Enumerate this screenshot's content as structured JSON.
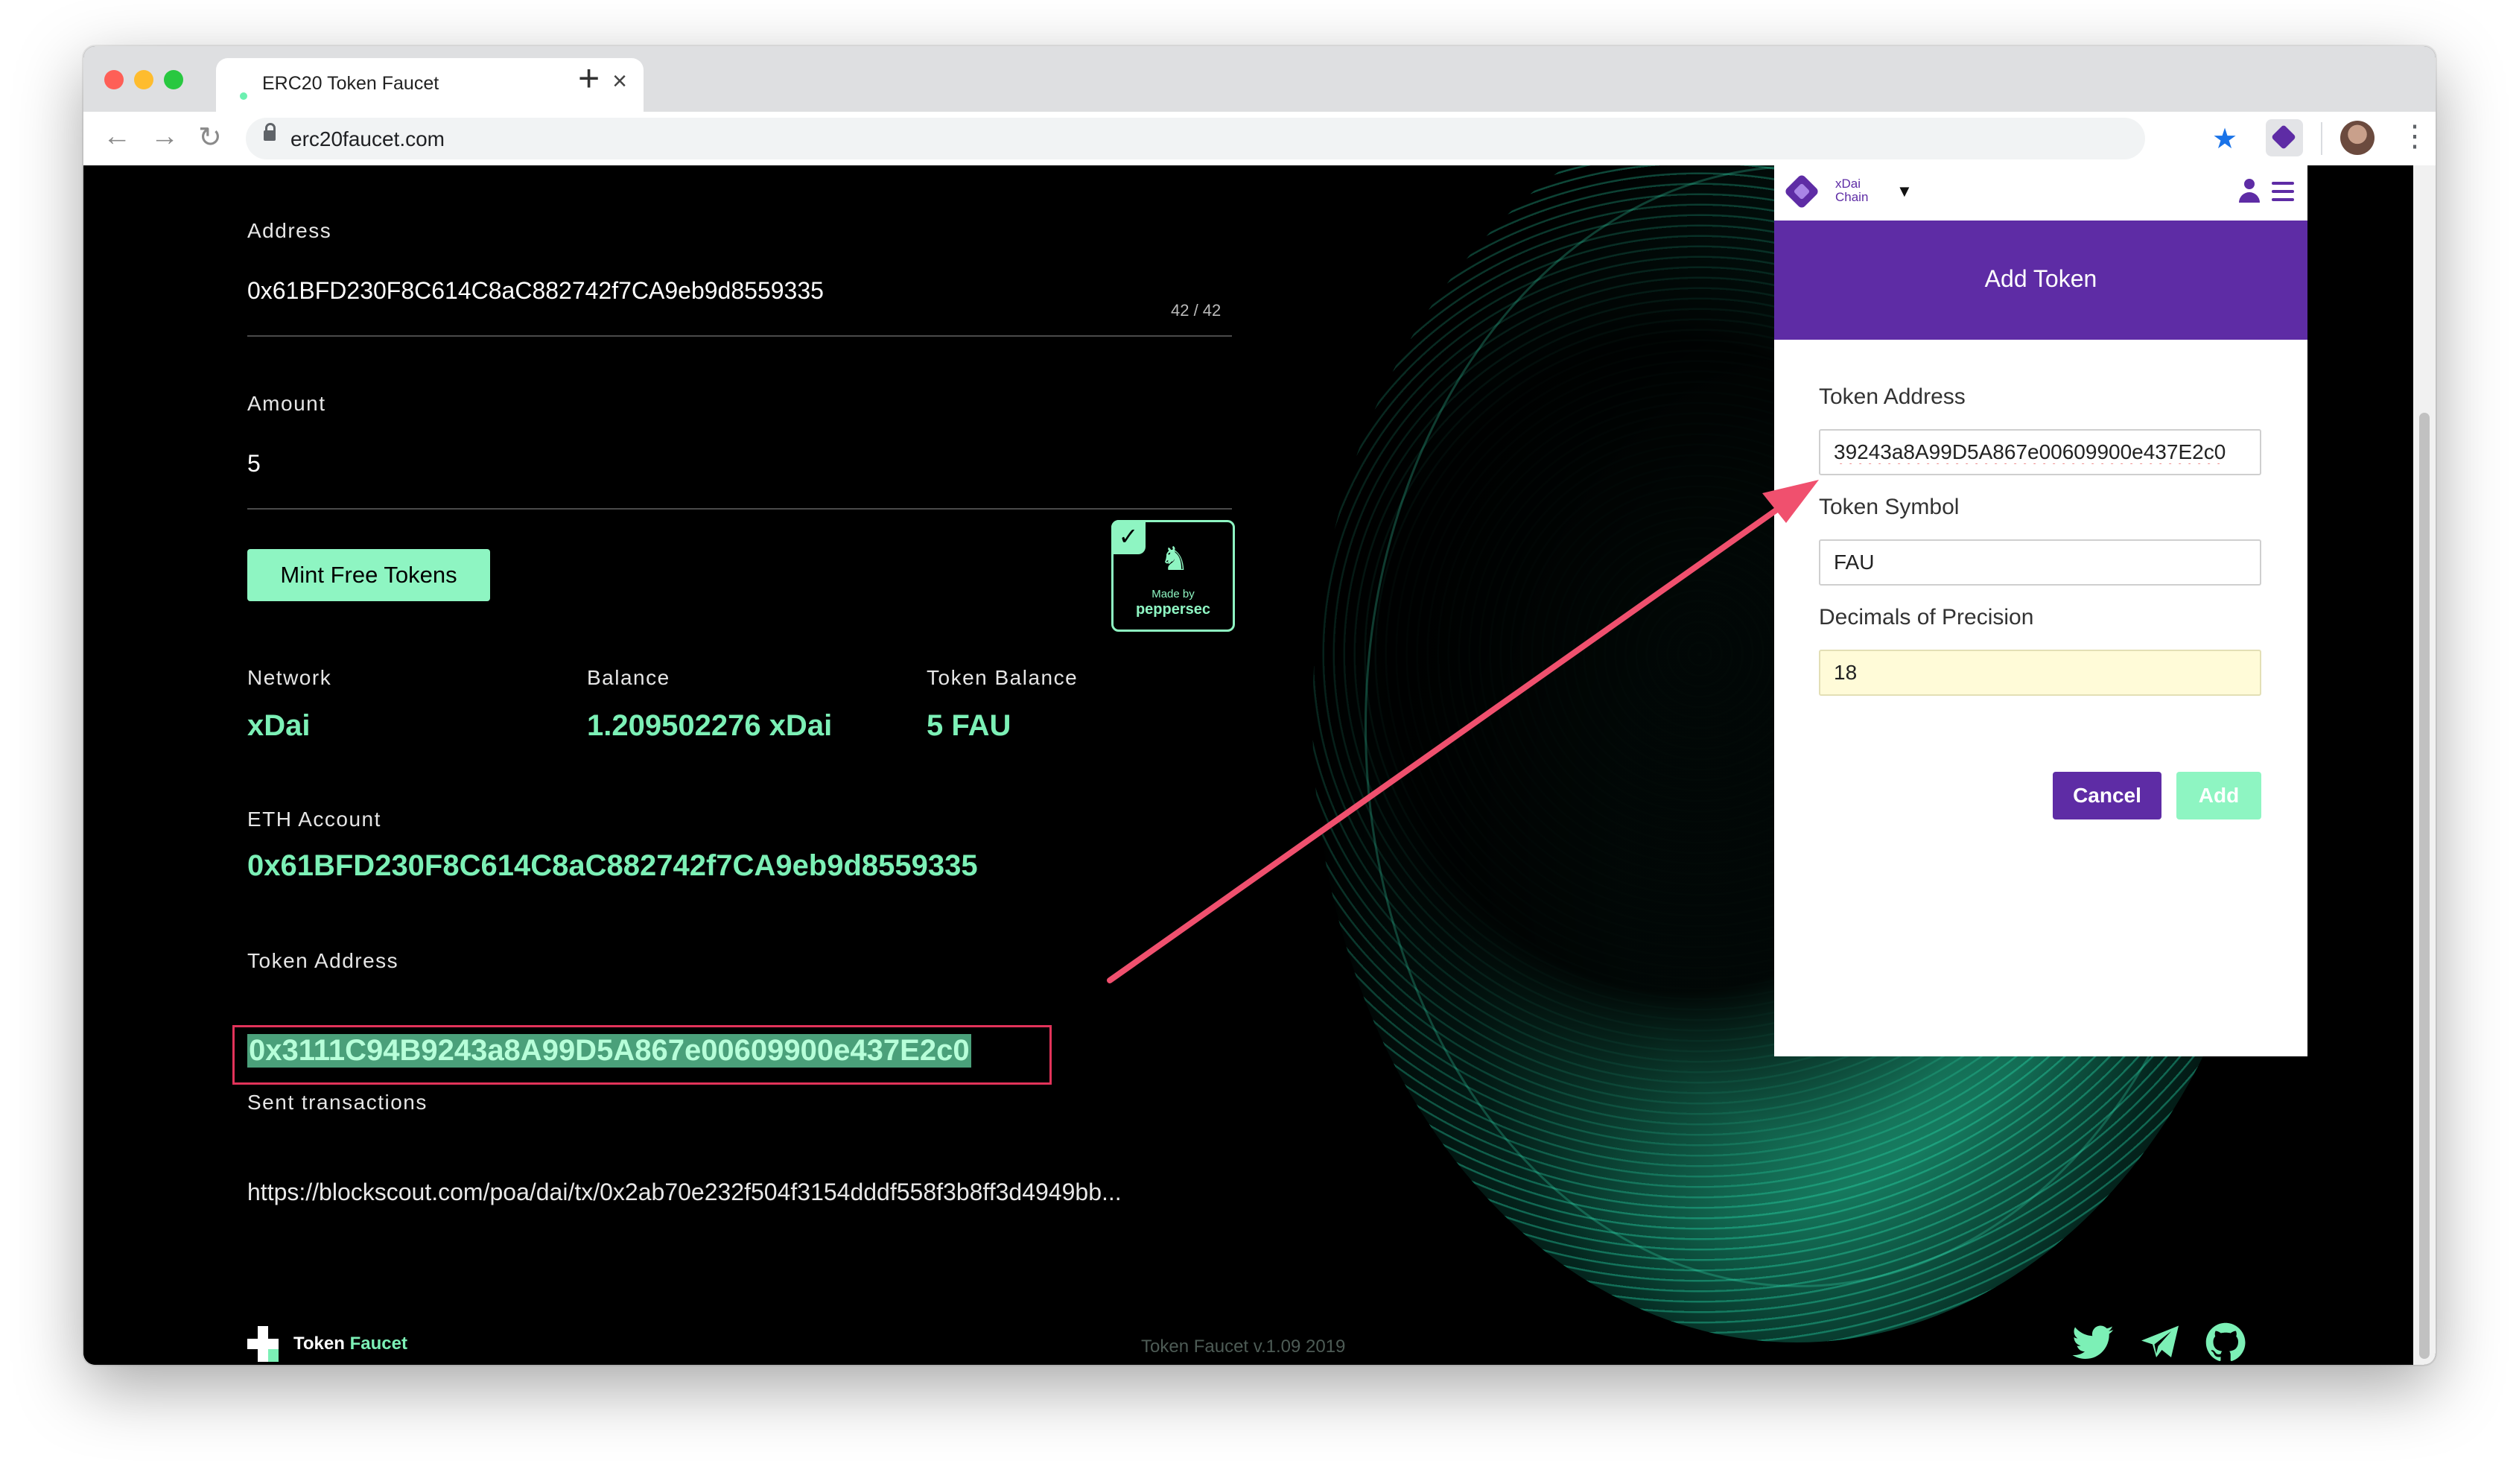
{
  "browser": {
    "tab_title": "ERC20 Token Faucet",
    "url": "erc20faucet.com"
  },
  "faucet": {
    "address_label": "Address",
    "address_value": "0x61BFD230F8C614C8aC882742f7CA9eb9d8559335",
    "address_counter": "42 / 42",
    "amount_label": "Amount",
    "amount_value": "5",
    "mint_button": "Mint Free Tokens",
    "badge_made_by": "Made by",
    "badge_brand": "peppersec",
    "network_label": "Network",
    "network_value": "xDai",
    "balance_label": "Balance",
    "balance_value": "1.209502276 xDai",
    "token_balance_label": "Token Balance",
    "token_balance_value": "5 FAU",
    "eth_account_label": "ETH Account",
    "eth_account_value": "0x61BFD230F8C614C8aC882742f7CA9eb9d8559335",
    "token_address_label": "Token Address",
    "token_address_value": "0x3111C94B9243a8A99D5A867e00609900e437E2c0",
    "sent_label": "Sent transactions",
    "sent_value": "https://blockscout.com/poa/dai/tx/0x2ab70e232f504f3154dddf558f3b8ff3d4949bb..."
  },
  "footer": {
    "brand_a": "Token",
    "brand_b": "Faucet",
    "version": "Token Faucet v.1.09 2019"
  },
  "popup": {
    "chain_line1": "xDai",
    "chain_line2": "Chain",
    "title": "Add Token",
    "token_address_label": "Token Address",
    "token_address_value": "39243a8A99D5A867e00609900e437E2c0",
    "token_symbol_label": "Token Symbol",
    "token_symbol_value": "FAU",
    "decimals_label": "Decimals of Precision",
    "decimals_value": "18",
    "cancel": "Cancel",
    "add": "Add"
  },
  "colors": {
    "accent_green": "#7cf0b6",
    "popup_purple": "#5e2ca5",
    "arrow_pink": "#f0506e",
    "highlight_red": "#e2335a"
  }
}
